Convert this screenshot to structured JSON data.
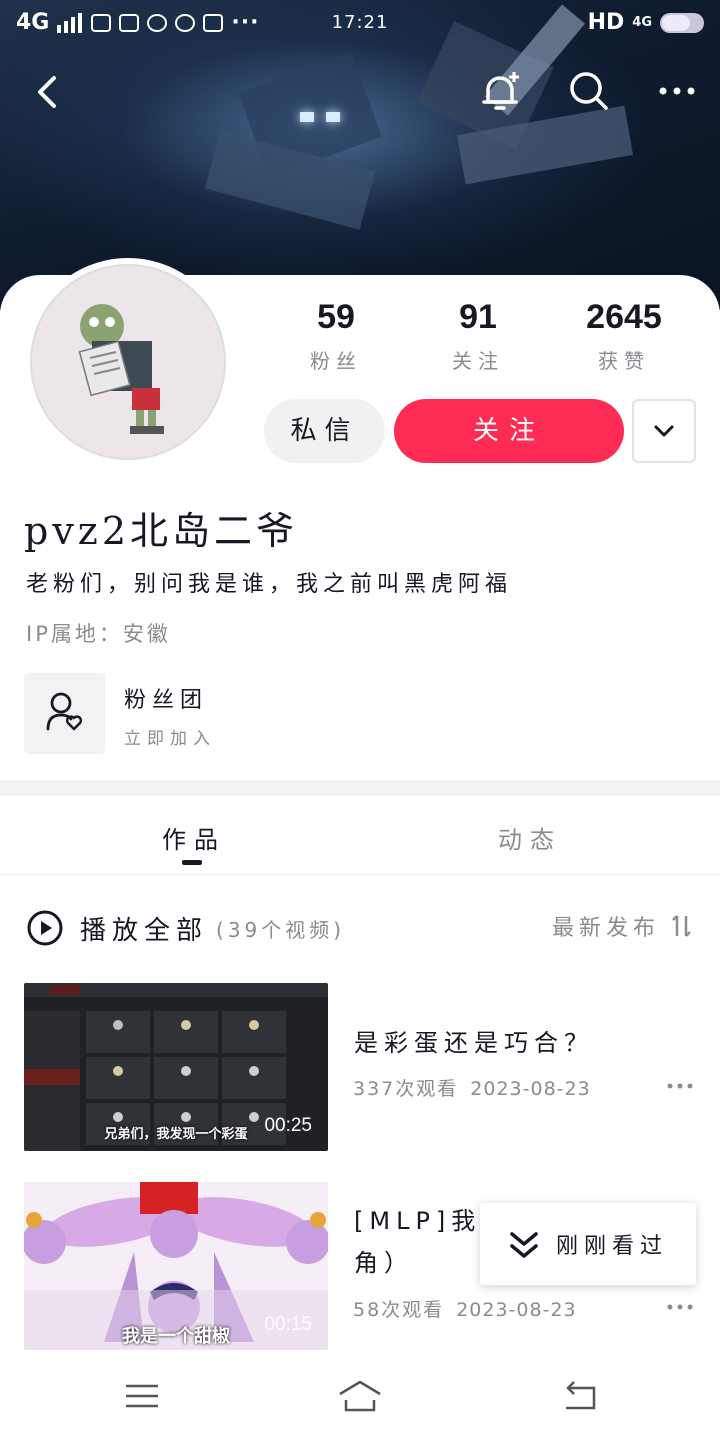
{
  "status_bar": {
    "network": "4G",
    "time": "17:21",
    "hd": "HD",
    "right_network": "4G"
  },
  "profile": {
    "stats": [
      {
        "value": "59",
        "label": "粉丝"
      },
      {
        "value": "91",
        "label": "关注"
      },
      {
        "value": "2645",
        "label": "获赞"
      }
    ],
    "message_label": "私信",
    "follow_label": "关注",
    "username": "pvz2北岛二爷",
    "bio": "老粉们，别问我是谁，我之前叫黑虎阿福",
    "ip_location": "IP属地：安徽",
    "fan_group": {
      "title": "粉丝团",
      "subtitle": "立即加入"
    }
  },
  "tabs": [
    {
      "label": "作品",
      "active": true
    },
    {
      "label": "动态",
      "active": false
    }
  ],
  "playall": {
    "label": "播放全部",
    "count": "(39个视频)"
  },
  "sort": {
    "label": "最新发布"
  },
  "videos": [
    {
      "title": "是彩蛋还是巧合？",
      "views": "337次观看",
      "date": "2023-08-23",
      "duration": "00:25",
      "subtitle": "兄弟们，我发现一个彩蛋"
    },
    {
      "title_line1": "[MLP]我是",
      "title_line2": "角）",
      "views": "58次观看",
      "date": "2023-08-23",
      "duration": "00:15",
      "subtitle": "我是一个甜椒"
    }
  ],
  "toast": {
    "label": "刚刚看过"
  },
  "colors": {
    "accent": "#fe2c55",
    "text": "#161823",
    "secondary": "#8a8b91"
  }
}
